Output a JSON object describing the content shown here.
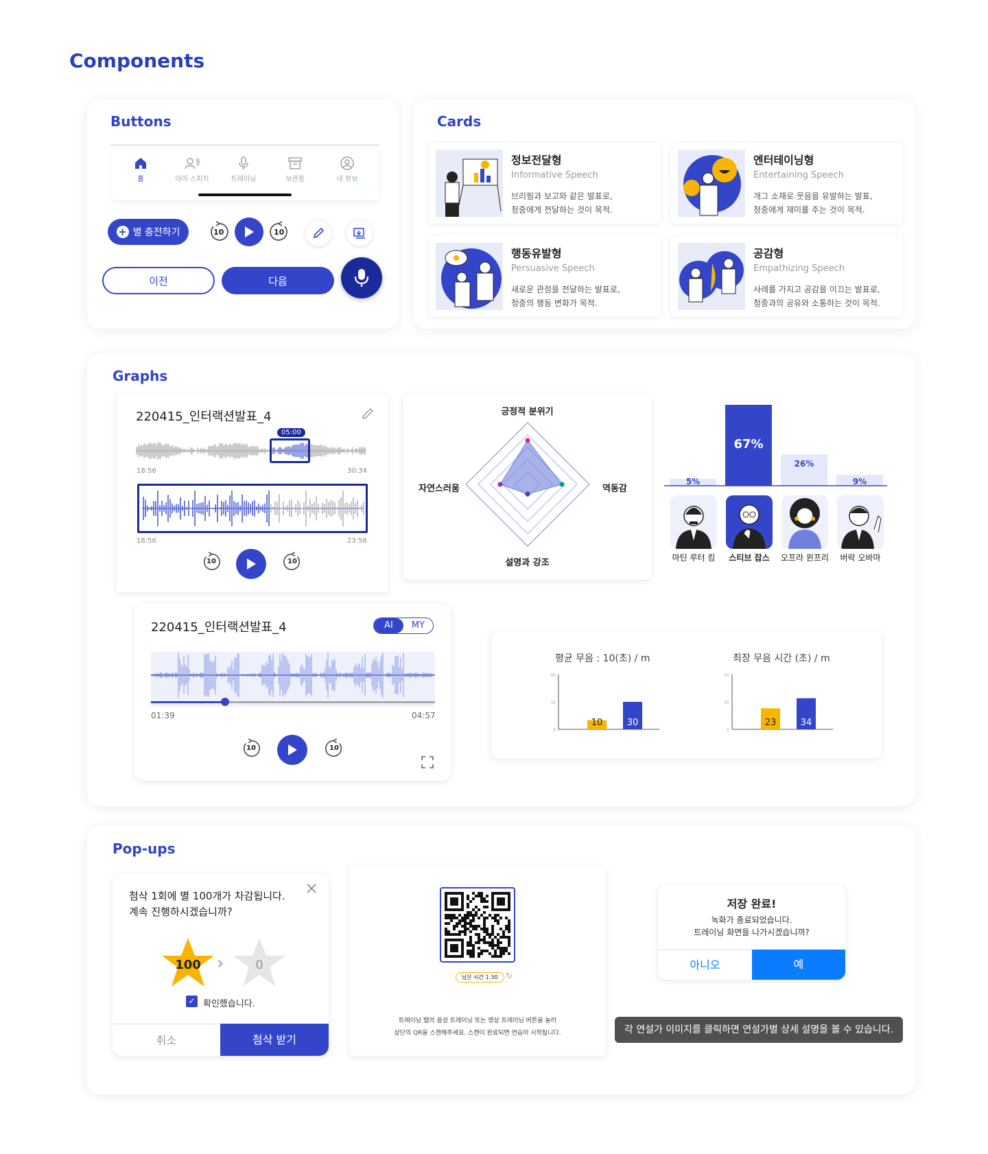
{
  "page_title": "Components",
  "buttons": {
    "title": "Buttons",
    "nav": [
      {
        "label": "홈",
        "icon": "home-icon"
      },
      {
        "label": "마이 스피치",
        "icon": "my-speech-icon"
      },
      {
        "label": "트레이닝",
        "icon": "mic-icon"
      },
      {
        "label": "보관함",
        "icon": "archive-icon"
      },
      {
        "label": "내 정보",
        "icon": "profile-icon"
      }
    ],
    "charge_label": "별 충전하기",
    "skip_back": "10",
    "skip_fwd": "10",
    "prev_label": "이전",
    "next_label": "다음"
  },
  "cards": {
    "title": "Cards",
    "items": [
      {
        "title": "정보전달형",
        "subtitle": "Informative Speech",
        "desc1": "브리핑과 보고와 같은 발표로,",
        "desc2": "청중에게 전달하는 것이 목적."
      },
      {
        "title": "엔터테이닝형",
        "subtitle": "Entertaining Speech",
        "desc1": "개그 소재로 웃음을 유발하는 발표,",
        "desc2": "청중에게 재미를 주는 것이 목적."
      },
      {
        "title": "행동유발형",
        "subtitle": "Persuasive Speech",
        "desc1": "새로운 관점을 전달하는 발표로,",
        "desc2": "청중의 행동 변화가 목적."
      },
      {
        "title": "공감형",
        "subtitle": "Empathizing Speech",
        "desc1": "사례를 가지고 공감을 이끄는 발표로,",
        "desc2": "청중과의 공유와 소통하는 것이 목적."
      }
    ]
  },
  "graphs": {
    "title": "Graphs",
    "player1": {
      "title": "220415_인터랙션발표_4",
      "marker": "05:00",
      "t_start": "18:56",
      "t_end": "30:34",
      "z_start": "18:56",
      "z_end": "23:56",
      "skip": "10"
    },
    "radar": {
      "top": "긍정적 분위기",
      "left": "자연스러움",
      "right": "역동감",
      "bottom": "설명과 강조"
    },
    "bars": {
      "values": [
        5,
        67,
        26,
        9
      ],
      "labels": [
        "5%",
        "67%",
        "26%",
        "9%"
      ],
      "names": [
        "마틴 루터 킹",
        "스티브 잡스",
        "오프라 윈프리",
        "버락 오바마"
      ]
    },
    "player2": {
      "title": "220415_인터랙션발표_4",
      "toggle_ai": "AI",
      "toggle_my": "MY",
      "t_cur": "01:39",
      "t_total": "04:57",
      "progress": 0.26,
      "skip": "10"
    },
    "silence": {
      "chart1_title": "평균 무음 : 10(초) / m",
      "chart2_title": "최장 무음 시간 (초) / m",
      "ticks": [
        "60",
        "30",
        "0"
      ]
    }
  },
  "chart_data": [
    {
      "type": "bar",
      "title": "",
      "categories": [
        "마틴 루터 킹",
        "스티브 잡스",
        "오프라 윈프리",
        "버락 오바마"
      ],
      "values": [
        5,
        67,
        26,
        9
      ]
    },
    {
      "type": "bar",
      "title": "평균 무음 : 10(초) / m",
      "categories": [
        "",
        ""
      ],
      "values": [
        10,
        30
      ],
      "ylim": [
        0,
        60
      ],
      "colors": [
        "#f7b500",
        "#3346c9"
      ]
    },
    {
      "type": "bar",
      "title": "최장 무음 시간 (초) / m",
      "categories": [
        "",
        ""
      ],
      "values": [
        23,
        34
      ],
      "ylim": [
        0,
        60
      ],
      "colors": [
        "#f7b500",
        "#3346c9"
      ]
    }
  ],
  "popups": {
    "title": "Pop-ups",
    "star": {
      "line1": "첨삭 1회에 별 100개가 차감됩니다.",
      "line2": "계속 진행하시겠습니까?",
      "from": "100",
      "to": "0",
      "check": "확인했습니다.",
      "cancel": "취소",
      "confirm": "첨삭 받기"
    },
    "qr": {
      "time": "남은 시간 1:30",
      "line1": "트레이닝 탭의 음성 트레이닝 또는 영상 트레이닝 버튼을 눌러",
      "line2": "상단의 QR을 스캔해주세요. 스캔이 완료되면 연습이 시작됩니다."
    },
    "saved": {
      "title": "저장 완료!",
      "line1": "녹화가 종료되었습니다.",
      "line2": "트레이닝 화면을 나가시겠습니까?",
      "no": "아니오",
      "yes": "예"
    },
    "toast": "각 연설가 이미지를 클릭하면 연설가별 상세 설명을 볼 수 있습니다."
  },
  "colors": {
    "primary": "#3346c9",
    "dark": "#1a2a9a",
    "yellow": "#f7b500",
    "ios_blue": "#0a7cff"
  }
}
